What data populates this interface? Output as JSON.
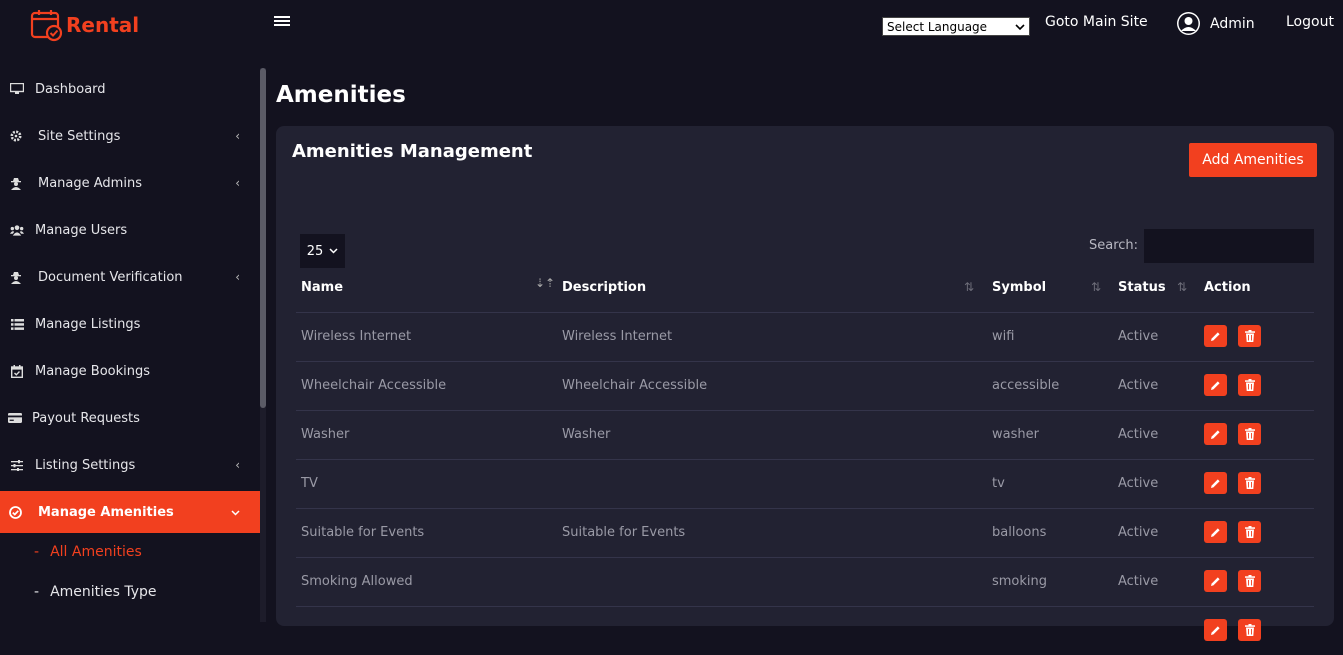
{
  "header": {
    "logo_text": "Rental",
    "language_select": "Select Language",
    "goto_main_site": "Goto Main Site",
    "admin_name": "Admin",
    "logout": "Logout"
  },
  "sidebar": {
    "items": [
      {
        "label": "Dashboard",
        "icon": "monitor-icon"
      },
      {
        "label": "Site Settings",
        "icon": "gear-icon"
      },
      {
        "label": "Manage Admins",
        "icon": "user-secret-icon"
      },
      {
        "label": "Manage Users",
        "icon": "users-icon"
      },
      {
        "label": "Document Verification",
        "icon": "user-secret-icon"
      },
      {
        "label": "Manage Listings",
        "icon": "list-icon"
      },
      {
        "label": "Manage Bookings",
        "icon": "calendar-check-icon"
      },
      {
        "label": "Payout Requests",
        "icon": "credit-card-icon"
      },
      {
        "label": "Listing Settings",
        "icon": "sliders-icon"
      },
      {
        "label": "Manage Amenities",
        "icon": "check-circle-icon"
      }
    ],
    "subitems": [
      {
        "label": "All Amenities"
      },
      {
        "label": "Amenities Type"
      }
    ]
  },
  "main": {
    "title": "Amenities",
    "card_title": "Amenities Management",
    "add_button": "Add Amenities",
    "page_size": "25",
    "search_label": "Search:"
  },
  "table": {
    "columns": [
      "Name",
      "Description",
      "Symbol",
      "Status",
      "Action"
    ],
    "rows": [
      {
        "name": "Wireless Internet",
        "description": "Wireless Internet",
        "symbol": "wifi",
        "status": "Active"
      },
      {
        "name": "Wheelchair Accessible",
        "description": "Wheelchair Accessible",
        "symbol": "accessible",
        "status": "Active"
      },
      {
        "name": "Washer",
        "description": "Washer",
        "symbol": "washer",
        "status": "Active"
      },
      {
        "name": "TV",
        "description": "",
        "symbol": "tv",
        "status": "Active"
      },
      {
        "name": "Suitable for Events",
        "description": "Suitable for Events",
        "symbol": "balloons",
        "status": "Active"
      },
      {
        "name": "Smoking Allowed",
        "description": "",
        "symbol": "smoking",
        "status": "Active"
      },
      {
        "name": "",
        "description": "",
        "symbol": "",
        "status": ""
      }
    ]
  },
  "colors": {
    "accent": "#f2401f",
    "background": "#13121f",
    "card": "#222232"
  }
}
